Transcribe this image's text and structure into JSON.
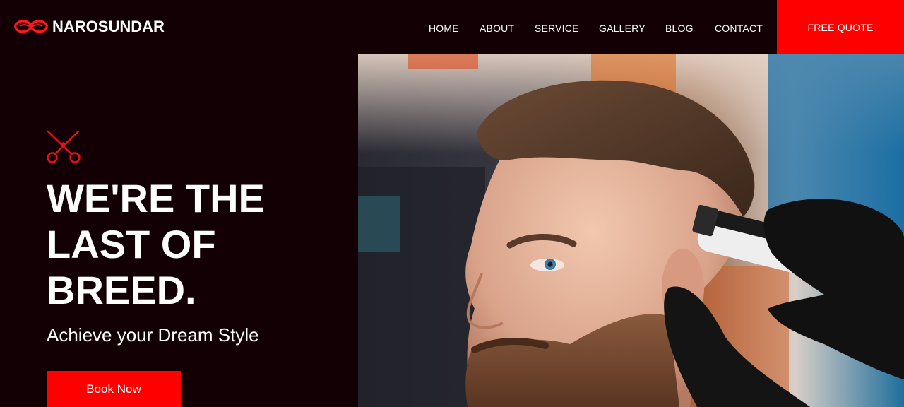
{
  "brand": {
    "name": "NAROSUNDAR",
    "logo_icon": "mustache-icon",
    "accent": "#ff0000",
    "background": "#120004"
  },
  "nav": {
    "items": [
      "HOME",
      "ABOUT",
      "SERVICE",
      "GALLERY",
      "BLOG",
      "CONTACT"
    ],
    "cta_label": "FREE QUOTE"
  },
  "hero": {
    "icon": "scissors-icon",
    "title_lines": [
      "WE'RE THE",
      "LAST OF",
      "BREED."
    ],
    "subtitle": "Achieve your Dream Style",
    "button_label": "Book Now",
    "image": "photo of bearded man getting a haircut with clippers"
  }
}
